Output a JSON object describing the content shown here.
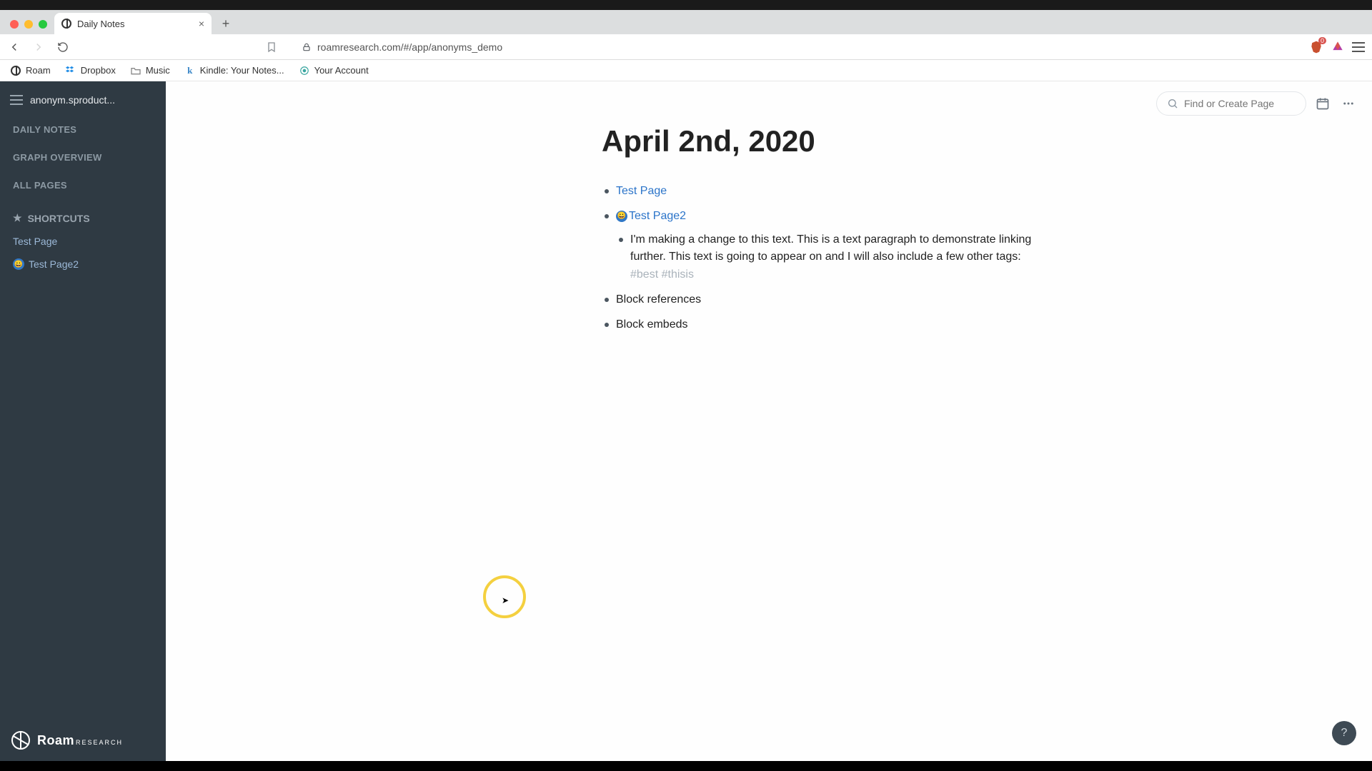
{
  "browser": {
    "tab_title": "Daily Notes",
    "url": "roamresearch.com/#/app/anonyms_demo",
    "bookmarks": [
      {
        "label": "Roam",
        "icon": "roam"
      },
      {
        "label": "Dropbox",
        "icon": "dropbox"
      },
      {
        "label": "Music",
        "icon": "folder"
      },
      {
        "label": "Kindle: Your Notes...",
        "icon": "k"
      },
      {
        "label": "Your Account",
        "icon": "target"
      }
    ],
    "ext_badge": "0"
  },
  "sidebar": {
    "db_name": "anonym.sproduct...",
    "nav": {
      "daily": "DAILY NOTES",
      "graph": "GRAPH OVERVIEW",
      "all": "ALL PAGES"
    },
    "shortcuts_header": "SHORTCUTS",
    "shortcuts": [
      {
        "label": "Test Page",
        "emoji": ""
      },
      {
        "label": "Test Page2",
        "emoji": "😀"
      }
    ],
    "brand": "Roam",
    "brand_sub": "RESEARCH"
  },
  "top": {
    "search_placeholder": "Find or Create Page"
  },
  "doc": {
    "title": "April 2nd, 2020",
    "b1": "Test Page",
    "b2": "Test Page2",
    "b2_child_text": "I'm making a change to this text. This is a text paragraph to demonstrate linking further. This text is going to appear on and I will also include a few other tags: ",
    "b2_tag1": "#best",
    "b2_tag2": "#thisis",
    "b3": "Block references",
    "b4": "Block embeds"
  }
}
